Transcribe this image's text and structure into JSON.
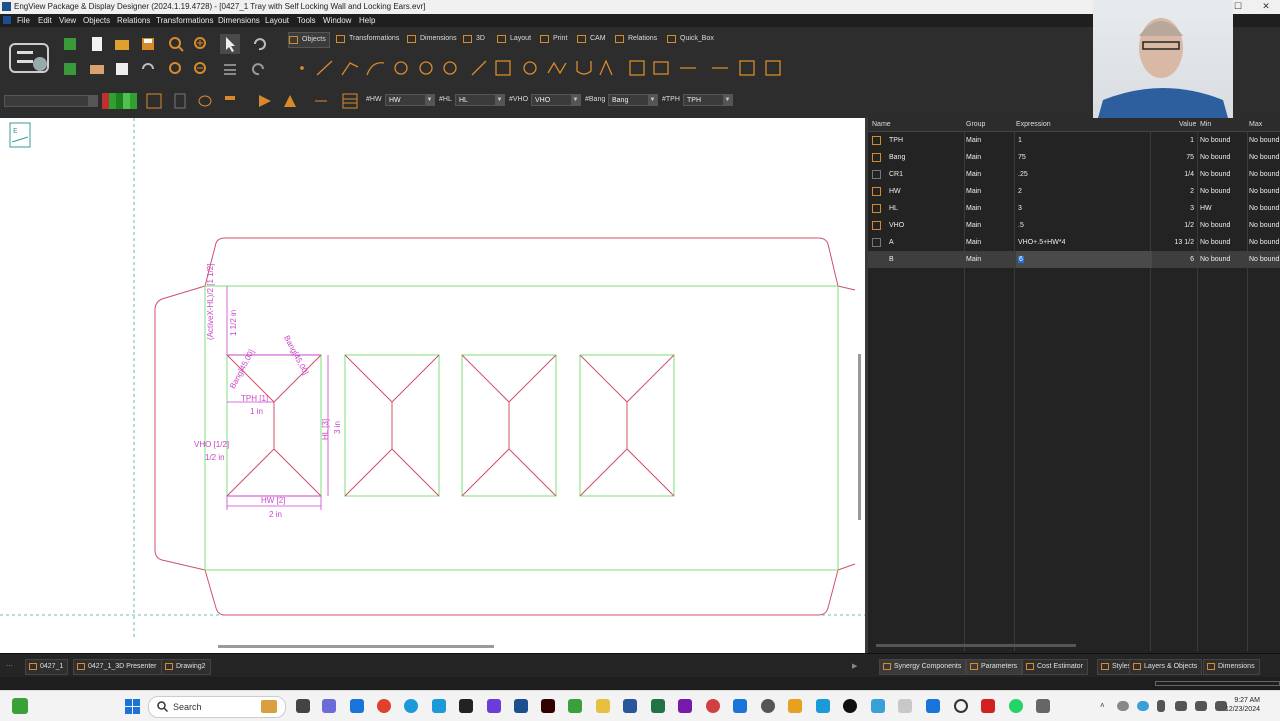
{
  "window": {
    "title": "EngView Package & Display Designer (2024.1.19.4728) - [0427_1 Tray with Self Locking Wall and Locking Ears.evr]",
    "controls": [
      "–",
      "☐",
      "✕"
    ]
  },
  "menu": [
    "File",
    "Edit",
    "View",
    "Objects",
    "Relations",
    "Transformations",
    "Dimensions",
    "Layout",
    "Tools",
    "Window",
    "Help"
  ],
  "ribbon_tabs": [
    "Objects",
    "Transformations",
    "Dimensions",
    "3D",
    "Layout",
    "Print",
    "CAM",
    "Relations",
    "Quick_Box"
  ],
  "params_bar": [
    {
      "label": "#HW",
      "value": "HW"
    },
    {
      "label": "#HL",
      "value": "HL"
    },
    {
      "label": "#VHO",
      "value": "VHO"
    },
    {
      "label": "#Bang",
      "value": "Bang"
    },
    {
      "label": "#TPH",
      "value": "TPH"
    }
  ],
  "drawing": {
    "dim_labels": {
      "hl_top_expr": "(ActiveX-HL)/2 [1 1/2]",
      "hl_top_val": "1 1/2 in",
      "bang_left": "Bang[45.00]",
      "bang_right": "Bang[45.00]",
      "tph_expr": "TPH [1]",
      "tph_val": "1 in",
      "hl_expr": "HL [3]",
      "hl_val": "3 in",
      "vho_expr": "VHO [1/2]",
      "vho_val": "1/2 in",
      "hw_expr": "HW [2]",
      "hw_val": "2 in"
    }
  },
  "parameters_table": {
    "columns": [
      "Name",
      "Group",
      "Expression",
      "Value",
      "Min",
      "Max"
    ],
    "rows": [
      {
        "name": "TPH",
        "group": "Main",
        "expression": "1",
        "value": "1",
        "min": "No bound",
        "max": "No bound"
      },
      {
        "name": "Bang",
        "group": "Main",
        "expression": "75",
        "value": "75",
        "min": "No bound",
        "max": "No bound"
      },
      {
        "name": "CR1",
        "group": "Main",
        "expression": ".25",
        "value": "1/4",
        "min": "No bound",
        "max": "No bound"
      },
      {
        "name": "HW",
        "group": "Main",
        "expression": "2",
        "value": "2",
        "min": "No bound",
        "max": "No bound"
      },
      {
        "name": "HL",
        "group": "Main",
        "expression": "3",
        "value": "3",
        "min": "HW",
        "max": "No bound"
      },
      {
        "name": "VHO",
        "group": "Main",
        "expression": ".5",
        "value": "1/2",
        "min": "No bound",
        "max": "No bound"
      },
      {
        "name": "A",
        "group": "Main",
        "expression": "VHO+.5+HW*4",
        "value": "13 1/2",
        "min": "No bound",
        "max": "No bound"
      },
      {
        "name": "B",
        "group": "Main",
        "expression": "6",
        "value": "6",
        "min": "No bound",
        "max": "No bound"
      }
    ]
  },
  "document_tabs": [
    "0427_1",
    "0427_1_3D Presenter",
    "Drawing2"
  ],
  "panel_tabs": [
    "Synergy Components",
    "Parameters",
    "Cost Estimator",
    "Styles",
    "Layers & Objects",
    "Dimensions"
  ],
  "taskbar": {
    "search_label": "Search",
    "time": "9:27 AM",
    "date": "12/23/2024"
  },
  "colors": {
    "cut_line": "#d0506a",
    "crease_line": "#7ee07e",
    "dimension": "#cc44cc",
    "accent": "#d88a2b"
  }
}
